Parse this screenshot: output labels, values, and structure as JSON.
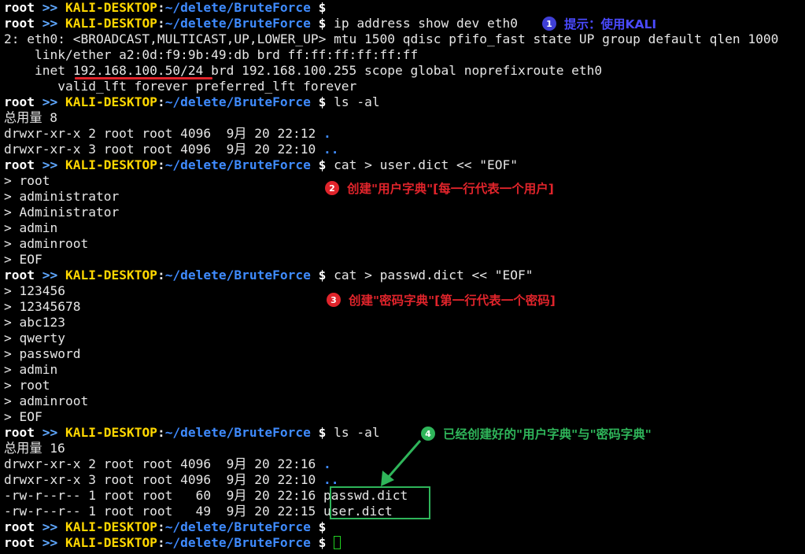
{
  "prompt": {
    "user": "root",
    "arrow": ">>",
    "host": "KALI-DESKTOP",
    "colon": ":",
    "path": "~/delete/BruteForce",
    "dollar": "$"
  },
  "lines": {
    "l1_cmd": "",
    "l2_cmd": " ip address show dev eth0",
    "l3": "2: eth0: <BROADCAST,MULTICAST,UP,LOWER_UP> mtu 1500 qdisc pfifo_fast state UP group default qlen 1000",
    "l4": "    link/ether a2:0d:f9:9b:49:db brd ff:ff:ff:ff:ff:ff",
    "l5": "    inet 192.168.100.50/24 brd 192.168.100.255 scope global noprefixroute eth0",
    "l6": "       valid_lft forever preferred_lft forever",
    "l7_cmd": " ls -al",
    "l8": "总用量 8",
    "l9": "drwxr-xr-x 2 root root 4096  9月 20 22:12 ",
    "l9_dir": ".",
    "l10": "drwxr-xr-x 3 root root 4096  9月 20 22:10 ",
    "l10_dir": "..",
    "l11_cmd": " cat > user.dict << \"EOF\"",
    "l12": "> root",
    "l13": "> administrator",
    "l14": "> Administrator",
    "l15": "> admin",
    "l16": "> adminroot",
    "l17": "> EOF",
    "l18_cmd": " cat > passwd.dict << \"EOF\"",
    "l19": "> 123456",
    "l20": "> 12345678",
    "l21": "> abc123",
    "l22": "> qwerty",
    "l23": "> password",
    "l24": "> admin",
    "l25": "> root",
    "l26": "> adminroot",
    "l27": "> EOF",
    "l28_cmd": " ls -al",
    "l29": "总用量 16",
    "l30": "drwxr-xr-x 2 root root 4096  9月 20 22:16 ",
    "l30_dir": ".",
    "l31": "drwxr-xr-x 3 root root 4096  9月 20 22:10 ",
    "l31_dir": "..",
    "l32": "-rw-r--r-- 1 root root   60  9月 20 22:16 passwd.dict",
    "l33": "-rw-r--r-- 1 root root   49  9月 20 22:15 user.dict",
    "l34_cmd": "",
    "l35_cmd": " "
  },
  "annotations": {
    "a1": {
      "num": "1",
      "text": "提示：使用KALI",
      "color": "#3f3fd6"
    },
    "a2": {
      "num": "2",
      "text": "创建\"用户字典\"[每一行代表一个用户]",
      "color": "#e0242b"
    },
    "a3": {
      "num": "3",
      "text": "创建\"密码字典\"[第一行代表一个密码]",
      "color": "#e0242b"
    },
    "a4": {
      "num": "4",
      "text": "已经创建好的\"用户字典\"与\"密码字典\"",
      "color": "#2fb55a"
    }
  },
  "colors": {
    "background": "#000000",
    "prompt_user": "#ffffff",
    "prompt_host": "#ffd700",
    "prompt_path": "#3f8bff",
    "highlight_red": "#e0242b",
    "highlight_green": "#2fb55a"
  }
}
